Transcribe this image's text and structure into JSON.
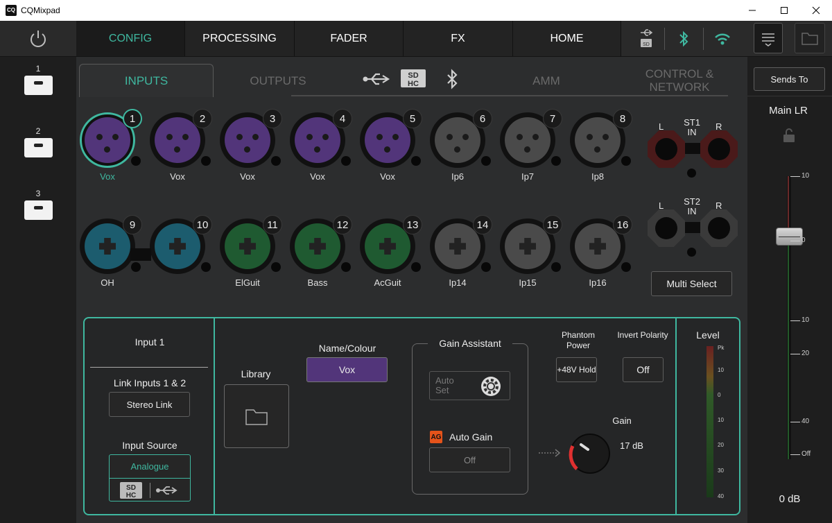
{
  "window": {
    "title": "CQMixpad",
    "app_icon": "CQ"
  },
  "nav": {
    "tabs": [
      "CONFIG",
      "PROCESSING",
      "FADER",
      "FX",
      "HOME"
    ],
    "active": "CONFIG"
  },
  "scenes": [
    "1",
    "2",
    "3"
  ],
  "subtabs": {
    "inputs": "INPUTS",
    "outputs": "OUTPUTS",
    "amm": "AMM",
    "control": "CONTROL & NETWORK"
  },
  "channels": [
    {
      "num": "1",
      "label": "Vox",
      "type": "xlr",
      "color": "#52357a"
    },
    {
      "num": "2",
      "label": "Vox",
      "type": "xlr",
      "color": "#52357a"
    },
    {
      "num": "3",
      "label": "Vox",
      "type": "xlr",
      "color": "#52357a"
    },
    {
      "num": "4",
      "label": "Vox",
      "type": "xlr",
      "color": "#52357a"
    },
    {
      "num": "5",
      "label": "Vox",
      "type": "xlr",
      "color": "#52357a"
    },
    {
      "num": "6",
      "label": "Ip6",
      "type": "xlr",
      "color": "#4a4a4a"
    },
    {
      "num": "7",
      "label": "Ip7",
      "type": "xlr",
      "color": "#4a4a4a"
    },
    {
      "num": "8",
      "label": "Ip8",
      "type": "xlr",
      "color": "#4a4a4a"
    },
    {
      "num": "9",
      "label": "OH",
      "type": "combo",
      "color": "#1c5c6e"
    },
    {
      "num": "10",
      "label": "",
      "type": "combo",
      "color": "#1c5c6e"
    },
    {
      "num": "11",
      "label": "ElGuit",
      "type": "combo",
      "color": "#1f5a31"
    },
    {
      "num": "12",
      "label": "Bass",
      "type": "combo",
      "color": "#1f5a31"
    },
    {
      "num": "13",
      "label": "AcGuit",
      "type": "combo",
      "color": "#1f5a31"
    },
    {
      "num": "14",
      "label": "Ip14",
      "type": "combo",
      "color": "#4a4a4a"
    },
    {
      "num": "15",
      "label": "Ip15",
      "type": "combo",
      "color": "#4a4a4a"
    },
    {
      "num": "16",
      "label": "Ip16",
      "type": "combo",
      "color": "#4a4a4a"
    }
  ],
  "stereo": [
    {
      "title": "ST1",
      "sub": "IN",
      "left": "L",
      "right": "R"
    },
    {
      "title": "ST2",
      "sub": "IN",
      "left": "L",
      "right": "R"
    }
  ],
  "multi_select": "Multi Select",
  "detail": {
    "input_name": "Input 1",
    "link_label": "Link Inputs 1 & 2",
    "stereo_link": "Stereo Link",
    "source_label": "Input Source",
    "source_value": "Analogue",
    "library": "Library",
    "name_colour_label": "Name/Colour",
    "name_value": "Vox",
    "gain_assistant": "Gain Assistant",
    "auto_set": "Auto Set",
    "ag_badge": "AG",
    "auto_gain": "Auto Gain",
    "auto_gain_value": "Off",
    "phantom_label": "Phantom Power",
    "phantom_value": "+48V Hold",
    "invert_label": "Invert Polarity",
    "invert_value": "Off",
    "gain_label": "Gain",
    "gain_value": "17 dB",
    "level_label": "Level",
    "meter_scale": [
      "Pk",
      "10",
      "0",
      "10",
      "20",
      "30",
      "40"
    ]
  },
  "fader": {
    "sends_to": "Sends To",
    "bus": "Main LR",
    "scale": [
      "10",
      "0",
      "10",
      "20",
      "40",
      "Off"
    ],
    "value": "0 dB"
  },
  "colors": {
    "accent": "#3fb8a0",
    "ag_badge": "#e5531a",
    "gain_arc": "#e03030"
  }
}
